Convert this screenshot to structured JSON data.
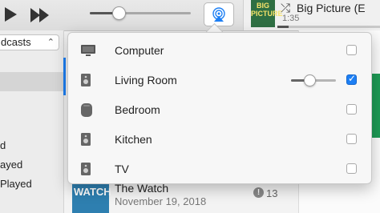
{
  "toolbar": {
    "play_icon": "play-icon",
    "fastforward_icon": "fast-forward-icon",
    "volume_level": 0.28,
    "airplay_icon": "airplay-icon"
  },
  "now_playing": {
    "album_art_text": "BIG PICTURE",
    "title": "Big Picture (E",
    "time": "1:35",
    "shuffle_icon": "shuffle-icon"
  },
  "sidebar": {
    "library_select": "dcasts",
    "items": [
      "d",
      "ayed",
      "Played"
    ]
  },
  "airplay": {
    "devices": [
      {
        "label": "Computer",
        "icon": "computer-icon",
        "checked": false
      },
      {
        "label": "Living Room",
        "icon": "speaker-icon",
        "checked": true,
        "volume": 0.4
      },
      {
        "label": "Bedroom",
        "icon": "homepod-icon",
        "checked": false
      },
      {
        "label": "Kitchen",
        "icon": "speaker-icon",
        "checked": false
      },
      {
        "label": "TV",
        "icon": "speaker-icon",
        "checked": false
      }
    ]
  },
  "episode": {
    "art_text": "WATCH",
    "title": "The Watch",
    "date": "November 19, 2018",
    "badge": "!",
    "count": "13"
  },
  "colors": {
    "accent": "#1d7ff4",
    "album_green": "#2f6f43"
  }
}
